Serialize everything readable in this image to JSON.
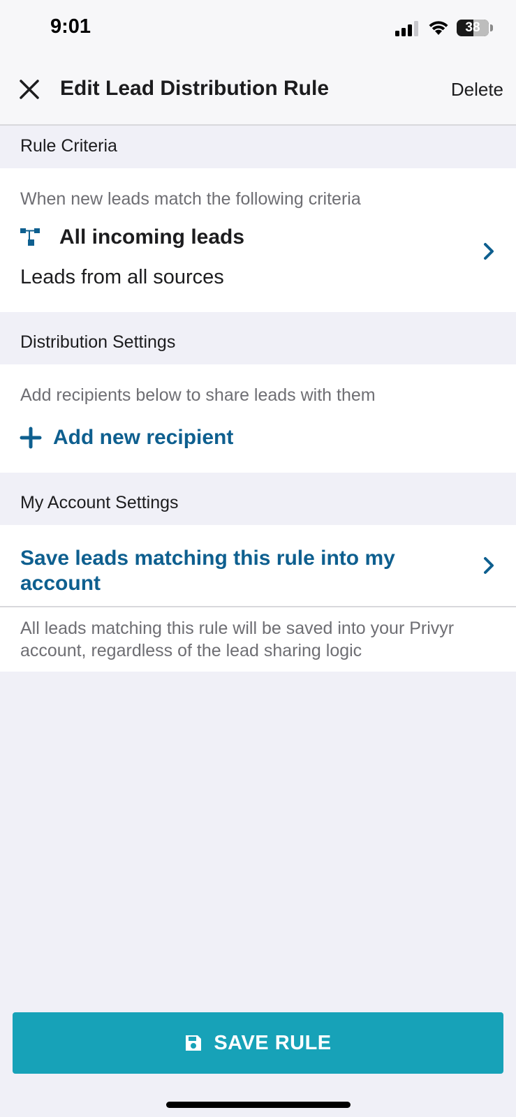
{
  "status_bar": {
    "time": "9:01",
    "battery": "38"
  },
  "nav": {
    "title": "Edit Lead Distribution Rule",
    "delete_label": "Delete",
    "close_icon": "close-icon"
  },
  "rule_criteria": {
    "header": "Rule Criteria",
    "description": "When new leads match the following criteria",
    "title": "All incoming leads",
    "subtitle": "Leads from all sources",
    "icon": "hierarchy-icon"
  },
  "distribution_settings": {
    "header": "Distribution Settings",
    "description": "Add recipients below to share leads with them",
    "add_label": "Add new recipient"
  },
  "account_settings": {
    "header": "My Account Settings",
    "save_leads_label": "Save leads matching this rule into my account",
    "footnote": "All leads matching this rule will be saved into your Privyr account, regardless of the lead sharing logic"
  },
  "footer": {
    "save_label": "SAVE RULE",
    "save_icon": "floppy-disk-icon"
  },
  "colors": {
    "accent": "#0e5f8f",
    "button": "#17a2b8",
    "background": "#f0f0f7"
  }
}
